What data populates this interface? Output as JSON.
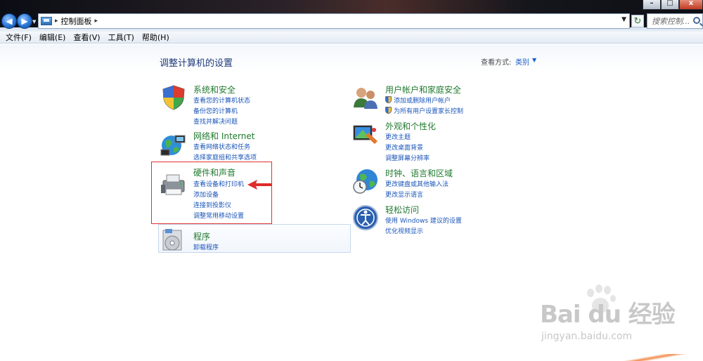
{
  "window": {
    "address": {
      "path": "控制面板",
      "separator_left": "▸",
      "separator_right": "▸"
    },
    "search_placeholder": "搜索控制...",
    "controls": {
      "minimize": "–",
      "maximize": "□",
      "close": "x"
    }
  },
  "menu": {
    "items": [
      "文件(F)",
      "编辑(E)",
      "查看(V)",
      "工具(T)",
      "帮助(H)"
    ]
  },
  "main": {
    "title": "调整计算机的设置",
    "view_by": {
      "label": "查看方式:",
      "value": "类别"
    },
    "categories": {
      "system": {
        "title": "系统和安全",
        "links": [
          "查看您的计算机状态",
          "备份您的计算机",
          "查找并解决问题"
        ]
      },
      "network": {
        "title": "网络和 Internet",
        "links": [
          "查看网络状态和任务",
          "选择家庭组和共享选项"
        ]
      },
      "hardware": {
        "title": "硬件和声音",
        "links": [
          "查看设备和打印机",
          "添加设备",
          "连接到投影仪",
          "调整常用移动设置"
        ]
      },
      "programs": {
        "title": "程序",
        "links": [
          "卸载程序"
        ]
      },
      "user": {
        "title": "用户帐户和家庭安全",
        "links": [
          "添加或删除用户帐户",
          "为所有用户设置家长控制"
        ]
      },
      "appearance": {
        "title": "外观和个性化",
        "links": [
          "更改主题",
          "更改桌面背景",
          "调整屏幕分辨率"
        ]
      },
      "clock": {
        "title": "时钟、语言和区域",
        "links": [
          "更改键盘或其他输入法",
          "更改显示语言"
        ]
      },
      "ease": {
        "title": "轻松访问",
        "links": [
          "使用 Windows 建议的设置",
          "优化视频显示"
        ]
      }
    }
  },
  "watermark": {
    "brand": "Bai  du 经验",
    "url": "jingyan.baidu.com"
  },
  "colors": {
    "category_title": "#1f7a2e",
    "link": "#1a55b8",
    "annotation": "#e03030"
  },
  "icons": [
    "back-arrow-icon",
    "forward-arrow-icon",
    "control-panel-icon",
    "refresh-icon",
    "search-icon",
    "shield-icon",
    "network-globe-icon",
    "printer-icon",
    "programs-disc-icon",
    "users-icon",
    "display-palette-icon",
    "globe-clock-icon",
    "ease-of-access-icon",
    "red-arrow-icon",
    "paw-icon"
  ]
}
